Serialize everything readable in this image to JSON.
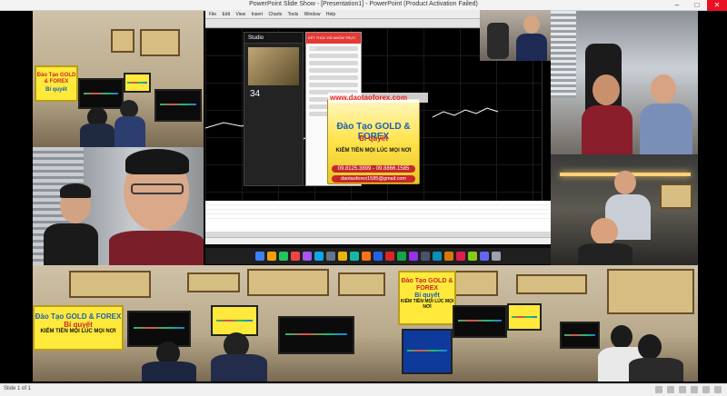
{
  "window": {
    "title": "PowerPoint Slide Show - [Presentation1] - PowerPoint (Product Activation Failed)",
    "minimize": "–",
    "maximize": "□",
    "close": "✕"
  },
  "status": {
    "slide_indicator": "Slide 1 of 1"
  },
  "mt4": {
    "menu": [
      "File",
      "Edit",
      "View",
      "Insert",
      "Charts",
      "Tools",
      "Window",
      "Help"
    ]
  },
  "studio": {
    "brand": "Studio",
    "viewer_count": "34"
  },
  "chat": {
    "header": "KẾT THÚC RÂ NHÓM TRỰC TIẾP"
  },
  "promo": {
    "url": "www.daotaoforex.com",
    "title": "Đào Tạo GOLD & FOREX",
    "subtitle": "Bí quyết",
    "slogan": "KIẾM TIỀN MỌI LÚC MỌI NƠI",
    "phone": "09.8125.3899 - 09.8866.1585",
    "email": "daotaoforex1585@gmail.com"
  },
  "signs": {
    "room_top_left": [
      "Đào Tạo GOLD & FOREX",
      "Bí quyết"
    ],
    "room_bottom_left": [
      "Đào Tạo GOLD & FOREX",
      "Bí quyết",
      "KIẾM TIỀN MỌI LÚC MỌI NƠI"
    ],
    "room_bottom_right": [
      "Đào Tạo GOLD & FOREX",
      "Bí quyết",
      "KIẾM TIỀN MỌI LÚC MỌI NƠI"
    ]
  },
  "colors": {
    "accent_red": "#e53935",
    "sign_yellow": "#ffe93b",
    "title_blue": "#1a5fb4",
    "chart_green": "#1ec06a"
  }
}
